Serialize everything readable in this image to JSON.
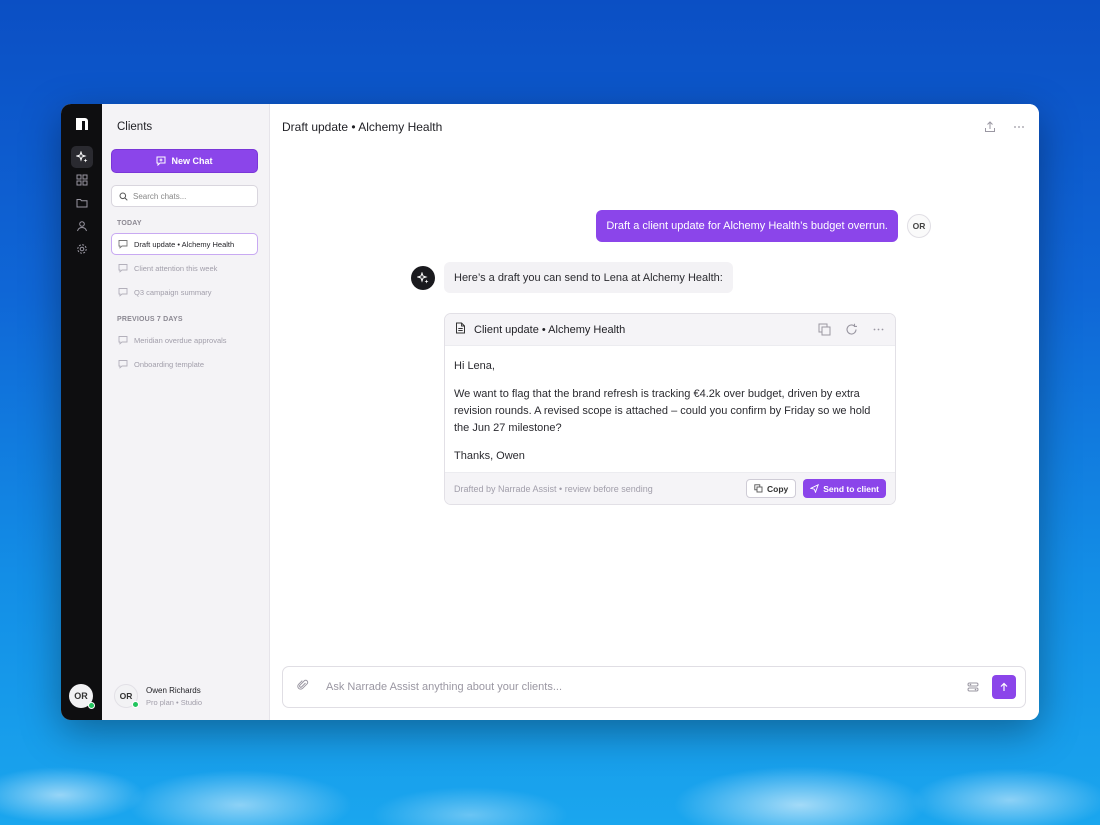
{
  "sidebar": {
    "title": "Clients",
    "new_chat_label": "New Chat",
    "search_placeholder": "Search chats...",
    "sections": [
      {
        "label": "TODAY",
        "items": [
          "Draft update • Alchemy Health",
          "Client attention this week",
          "Q3 campaign summary"
        ]
      },
      {
        "label": "PREVIOUS 7 DAYS",
        "items": [
          "Meridian overdue approvals",
          "Onboarding template"
        ]
      }
    ],
    "user": {
      "initials": "OR",
      "name": "Owen Richards",
      "plan": "Pro plan • Studio"
    }
  },
  "rail": {
    "avatar_initials": "OR"
  },
  "header": {
    "title": "Draft update • Alchemy Health"
  },
  "conversation": {
    "user_message": "Draft a client update for Alchemy Health’s budget overrun.",
    "user_initials": "OR",
    "assistant_message": "Here’s a draft you can send to Lena at Alchemy Health:",
    "draft": {
      "title": "Client update • Alchemy Health",
      "greeting": "Hi Lena,",
      "body": "We want to flag that the brand refresh is tracking €4.2k over budget, driven by extra revision rounds. A revised scope is attached – could you confirm by Friday so we hold the Jun 27 milestone?",
      "signoff": "Thanks, Owen",
      "note": "Drafted by Narrade Assist • review before sending",
      "copy_label": "Copy",
      "send_label": "Send to client"
    }
  },
  "composer": {
    "placeholder": "Ask Narrade Assist anything about your clients..."
  },
  "colors": {
    "accent": "#8b45ea",
    "rail": "#0e0e10",
    "sidebar": "#f4f3f6",
    "online": "#22c55e"
  }
}
